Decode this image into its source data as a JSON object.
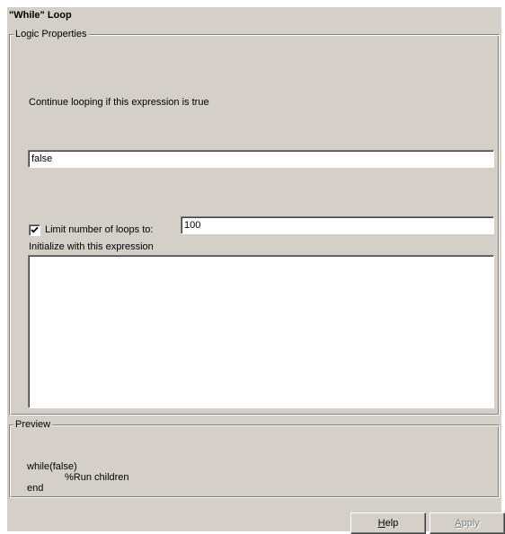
{
  "window": {
    "title": "\"While\" Loop"
  },
  "logic_properties": {
    "group_label": "Logic Properties",
    "condition_label": "Continue looping if this expression is true",
    "condition_value": "false",
    "limit_checkbox": {
      "checked": true,
      "label": "Limit number of loops to:"
    },
    "limit_value": "100",
    "init_label": "Initialize with this expression",
    "init_value": ""
  },
  "preview": {
    "group_label": "Preview",
    "line1": "while(false)",
    "line2": "%Run children",
    "line3": "end"
  },
  "buttons": {
    "help": {
      "accel": "H",
      "rest": "elp"
    },
    "apply": {
      "accel": "A",
      "rest": "pply",
      "enabled": false
    }
  }
}
